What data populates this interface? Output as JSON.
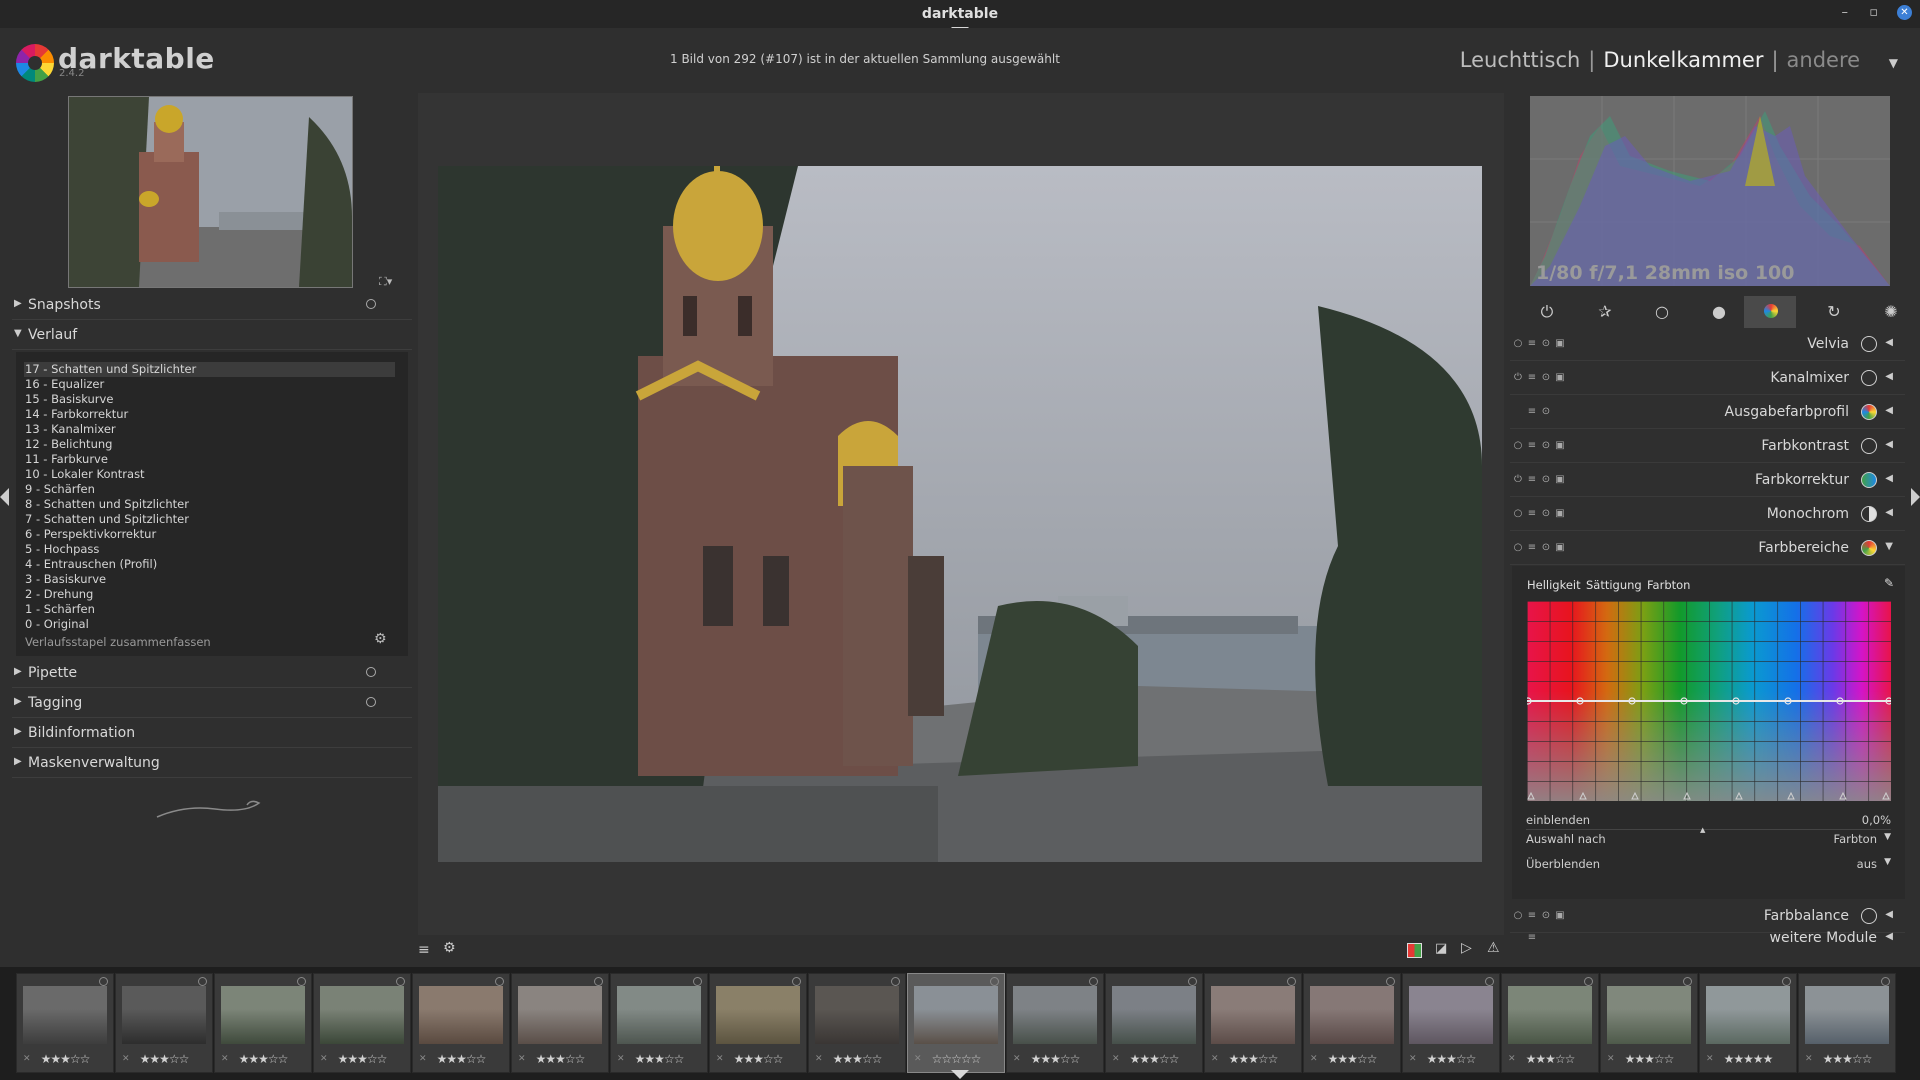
{
  "window": {
    "title": "darktable",
    "minimize": "–",
    "restore": "▫",
    "close": "✕"
  },
  "app": {
    "name": "darktable",
    "version": "2.4.2"
  },
  "status_message": "1 Bild von 292 (#107) ist in der aktuellen Sammlung ausgewählt",
  "views": {
    "lighttable": "Leuchttisch",
    "darkroom": "Dunkelkammer",
    "other": "andere",
    "separator": "|",
    "active": "darkroom"
  },
  "left_panel": {
    "sections": {
      "snapshots": "Snapshots",
      "history": "Verlauf",
      "pipette": "Pipette",
      "tagging": "Tagging",
      "image_info": "Bildinformation",
      "mask_manager": "Maskenverwaltung"
    },
    "history_items": [
      "17 - Schatten und Spitzlichter",
      "16 - Equalizer",
      "15 - Basiskurve",
      "14 - Farbkorrektur",
      "13 - Kanalmixer",
      "12 - Belichtung",
      "11 - Farbkurve",
      "10 - Lokaler Kontrast",
      "9 - Schärfen",
      "8 - Schatten und Spitzlichter",
      "7 - Schatten und Spitzlichter",
      "6 - Perspektivkorrektur",
      "5 - Hochpass",
      "4 - Entrauschen (Profil)",
      "3 - Basiskurve",
      "2 - Drehung",
      "1 - Schärfen",
      "0 - Original"
    ],
    "history_selected_index": 0,
    "history_compress": "Verlaufsstapel zusammenfassen"
  },
  "right_panel": {
    "exif": "1/80 f/7,1 28mm iso 100",
    "module_groups": [
      "power",
      "favorites",
      "basic",
      "tone",
      "color",
      "correct",
      "effect"
    ],
    "active_group": "color",
    "modules": [
      {
        "name": "Velvia",
        "icon": "velvia-icon",
        "enabled": false
      },
      {
        "name": "Kanalmixer",
        "icon": "channel-mixer-icon",
        "enabled": true
      },
      {
        "name": "Ausgabefarbprofil",
        "icon": "output-profile-icon",
        "enabled": true
      },
      {
        "name": "Farbkontrast",
        "icon": "color-contrast-icon",
        "enabled": false
      },
      {
        "name": "Farbkorrektur",
        "icon": "color-correction-icon",
        "enabled": true
      },
      {
        "name": "Monochrom",
        "icon": "monochrome-icon",
        "enabled": false
      },
      {
        "name": "Farbbereiche",
        "icon": "color-zones-icon",
        "enabled": false,
        "expanded": true
      }
    ],
    "color_zones": {
      "tabs": [
        "Helligkeit",
        "Sättigung",
        "Farbton"
      ],
      "fade_label": "einblenden",
      "fade_value": "0,0%",
      "select_by_label": "Auswahl nach",
      "select_by_value": "Farbton",
      "blend_label": "Überblenden",
      "blend_value": "aus"
    },
    "bottom_modules": [
      {
        "name": "Farbbalance",
        "icon": "color-balance-icon"
      },
      {
        "name": "weitere Module",
        "icon": "more-modules-icon"
      }
    ]
  },
  "filmstrip": {
    "count": 19,
    "active_index": 9,
    "ratings": [
      3,
      3,
      3,
      3,
      3,
      3,
      3,
      3,
      3,
      0,
      3,
      3,
      3,
      3,
      3,
      3,
      3,
      5,
      3
    ],
    "rating_glyph": "★",
    "empty_glyph": "☆",
    "reject_glyph": "✕"
  },
  "colors": {
    "background": "#2f2f2f",
    "panel": "#262626",
    "accent": "#3c7fd6",
    "text": "#d8d8d8"
  }
}
